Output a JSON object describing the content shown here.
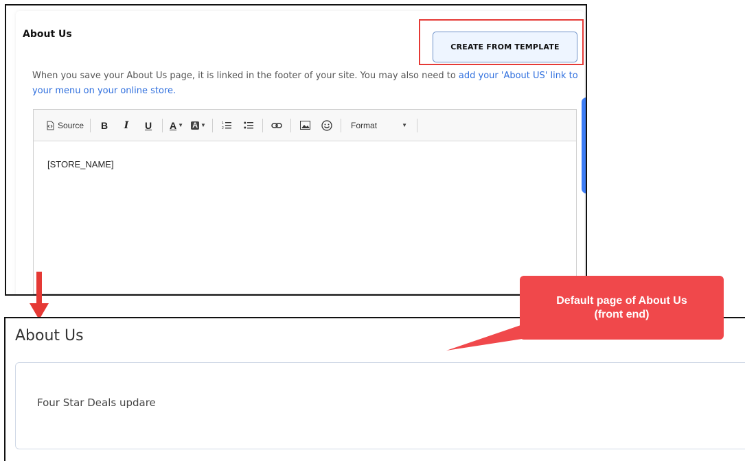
{
  "admin": {
    "title": "About Us",
    "template_button": "CREATE FROM TEMPLATE",
    "description_text": "When you save your About Us page, it is linked in the footer of your site. You may also need to ",
    "description_link": "add your 'About US' link to your menu on your online store.",
    "editor": {
      "toolbar": {
        "source_label": "Source",
        "bold": "B",
        "italic": "I",
        "underline": "U",
        "text_color": "A",
        "bg_color": "A",
        "format_label": "Format"
      },
      "content": "[STORE_NAME]"
    }
  },
  "front": {
    "title": "About Us",
    "content": "Four Star Deals updare"
  },
  "callout": {
    "text": "Default page of About Us (front end)"
  },
  "colors": {
    "annotation_red": "#e53935",
    "callout_red": "#f0484b",
    "link_blue": "#2f6fde",
    "tab_blue": "#3d7df5"
  }
}
